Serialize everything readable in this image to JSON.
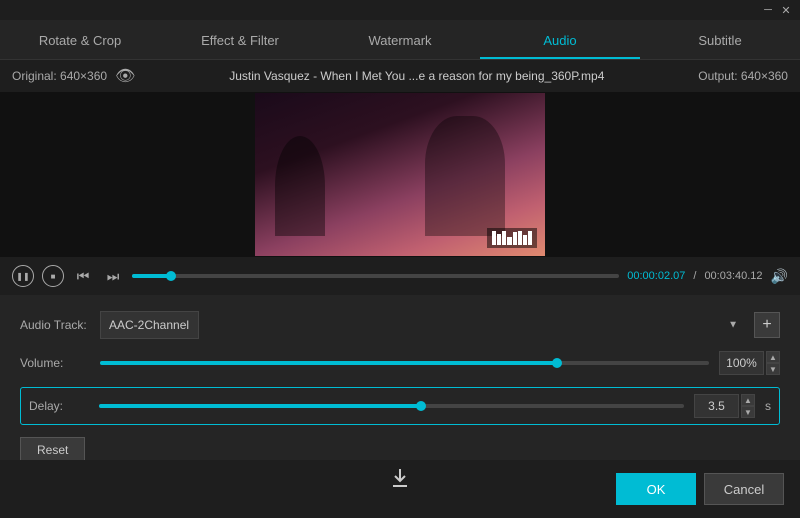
{
  "titleBar": {
    "minimizeIcon": "─",
    "closeIcon": "✕"
  },
  "tabs": [
    {
      "id": "rotate-crop",
      "label": "Rotate & Crop",
      "active": false
    },
    {
      "id": "effect-filter",
      "label": "Effect & Filter",
      "active": false
    },
    {
      "id": "watermark",
      "label": "Watermark",
      "active": false
    },
    {
      "id": "audio",
      "label": "Audio",
      "active": true
    },
    {
      "id": "subtitle",
      "label": "Subtitle",
      "active": false
    }
  ],
  "infoBar": {
    "original": "Original: 640×360",
    "filename": "Justin Vasquez - When I Met You ...e a reason for my being_360P.mp4",
    "output": "Output: 640×360"
  },
  "player": {
    "currentTime": "00:00:02.07",
    "separator": "/",
    "totalTime": "00:03:40.12",
    "progressPercent": 8
  },
  "audioPanel": {
    "audioTrackLabel": "Audio Track:",
    "audioTrackValue": "AAC-2Channel",
    "addIcon": "+",
    "volumeLabel": "Volume:",
    "volumePercent": "100%",
    "volumeSliderPercent": 75,
    "delayLabel": "Delay:",
    "delayValue": "3.5",
    "delayUnit": "s",
    "delaySliderPercent": 55,
    "resetLabel": "Reset"
  },
  "footer": {
    "okLabel": "OK",
    "cancelLabel": "Cancel"
  }
}
